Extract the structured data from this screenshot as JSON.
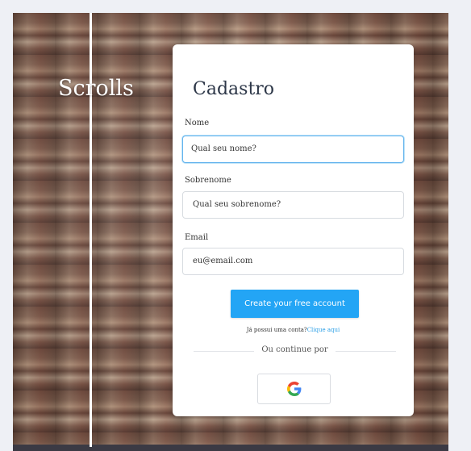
{
  "brand": {
    "name": "Scrolls"
  },
  "form": {
    "title": "Cadastro",
    "fields": [
      {
        "label": "Nome",
        "placeholder": "Qual seu nome?",
        "value": ""
      },
      {
        "label": "Sobrenome",
        "placeholder": "Qual seu sobrenome?",
        "value": ""
      },
      {
        "label": "Email",
        "placeholder": "eu@email.com",
        "value": ""
      }
    ],
    "submit_label": "Create your free account",
    "login_prompt": "Já possui uma conta?",
    "login_link": "Clique aqui",
    "divider_text": "Ou continue por",
    "social": [
      {
        "provider": "google",
        "icon": "google-icon"
      }
    ]
  },
  "colors": {
    "accent": "#23a5f5",
    "link": "#2b9fe6",
    "focus_border": "#63b3ed"
  }
}
